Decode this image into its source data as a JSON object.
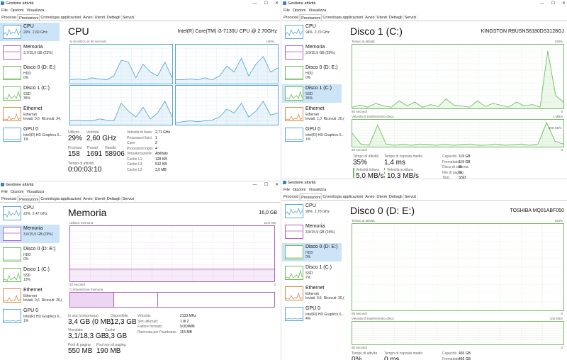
{
  "app_title": "Gestione attività",
  "menu": [
    "File",
    "Opzioni",
    "Visualizza"
  ],
  "tabs": [
    "Processi",
    "Prestazioni",
    "Cronologia applicazioni",
    "Avvio",
    "Utenti",
    "Dettagli",
    "Servizi"
  ],
  "win_buttons": [
    "—",
    "☐",
    "✕"
  ],
  "colors": {
    "cpu": "#5ba7d8",
    "mem": "#b05fc1",
    "disk": "#6fbf5e",
    "eth": "#d98c4b",
    "gpu": "#5ba7d8",
    "selected": "#cce4f7"
  },
  "w1": {
    "sidebar": [
      {
        "name": "CPU",
        "sub": "29%  2,60 GHz"
      },
      {
        "name": "Memoria",
        "sub": "3,7/15,9 GB (23%)"
      },
      {
        "name": "Disco 0 (D: E:)",
        "sub": "HDD\n0%"
      },
      {
        "name": "Disco 1 (C:)",
        "sub": "SSD\n35%"
      },
      {
        "name": "Ethernet",
        "sub": "Ethernet\nInviati: 0,6  Ricevuti: 34,"
      },
      {
        "name": "GPU 0",
        "sub": "Intel(R) HD Graphics 6...\n1%"
      }
    ],
    "title": "CPU",
    "subtitle": "Intel(R) Core(TM) i3-7130U CPU @ 2.70GHz",
    "graph_label": "% di utilizzo in 60 secondi",
    "graph_max": "100%",
    "stats": [
      {
        "label": "Utilizzo",
        "value": "29%"
      },
      {
        "label": "Velocità",
        "value": "2,60 GHz"
      },
      {
        "label": "Processi",
        "value": "158"
      },
      {
        "label": "Thread",
        "value": "1691"
      },
      {
        "label": "Handle",
        "value": "58906"
      },
      {
        "label": "Tempo di attività",
        "value": "0:00:03:10"
      }
    ],
    "kv": [
      {
        "k": "Velocità di base:",
        "v": "2,71 GHz"
      },
      {
        "k": "Processori fisici:",
        "v": "1"
      },
      {
        "k": "Core:",
        "v": "2"
      },
      {
        "k": "Processori logici:",
        "v": "4"
      },
      {
        "k": "Virtualizzazione:",
        "v": "Abilitato"
      },
      {
        "k": "Cache L1:",
        "v": "128 KB"
      },
      {
        "k": "Cache L2:",
        "v": "512 KB"
      },
      {
        "k": "Cache L3:",
        "v": "3,0 MB"
      }
    ]
  },
  "w2": {
    "sidebar": [
      {
        "name": "CPU",
        "sub": "94%  2,70 GHz"
      },
      {
        "name": "Memoria",
        "sub": "3,9/15,9 GB (25%)"
      },
      {
        "name": "Disco 0 (D: E:)",
        "sub": "HDD\n0%"
      },
      {
        "name": "Disco 1 (C:)",
        "sub": "SSD\n35%"
      },
      {
        "name": "Ethernet",
        "sub": "Ethernet\nInviati: 1,0  Ricevuti: 26,("
      },
      {
        "name": "GPU 0",
        "sub": "Intel(R) HD Graphics 6...\n1%"
      }
    ],
    "title": "Disco 1 (C:)",
    "subtitle": "KINGSTON RBUSNS8180DS3128GJ",
    "g1_label": "Tempo di attività",
    "g1_max": "100%",
    "g1_left": "60 secondi",
    "g1_right": "0",
    "g2_label": "Velocità di trasferimento disco",
    "g2_max": "1 MB/s",
    "g2_mid": "800 KB/s",
    "g2_left": "60 secondi",
    "g2_right": "0",
    "stats": [
      {
        "label": "Tempo di attività",
        "value": "35%"
      },
      {
        "label": "Tempo di risposta medio",
        "value": "1,4 ms"
      },
      {
        "label": "Velocità lettura",
        "value": "5,0 MB/s"
      },
      {
        "label": "Velocità scrittura",
        "value": "10,3 MB/s"
      }
    ],
    "kv": [
      {
        "k": "Capacità:",
        "v": "119 GB"
      },
      {
        "k": "Formattato:",
        "v": "119 GB"
      },
      {
        "k": "Disco di sistema:",
        "v": "Sì"
      },
      {
        "k": "File di paging:",
        "v": "Sì"
      },
      {
        "k": "Tipo:",
        "v": "SSD"
      }
    ]
  },
  "w3": {
    "sidebar": [
      {
        "name": "CPU",
        "sub": "22%  2,47 GHz"
      },
      {
        "name": "Memoria",
        "sub": "3,6/15,9 GB (23%)"
      },
      {
        "name": "Disco 0 (D: E:)",
        "sub": "HDD\n0%"
      },
      {
        "name": "Disco 1 (C:)",
        "sub": "SSD\n13%"
      },
      {
        "name": "Ethernet",
        "sub": "Ethernet\nInviati: 0,6  Ricevuti: 36,("
      },
      {
        "name": "GPU 0",
        "sub": "Intel(R) HD Graphics 6...\n1%"
      }
    ],
    "title": "Memoria",
    "subtitle": "16,0 GB",
    "g1_label": "Utilizzo memoria",
    "g1_max": "15,9 GB",
    "g1_left": "60 secondi",
    "g1_right": "0",
    "g2_label": "Composizione memoria",
    "stats": [
      {
        "label": "In uso (compressa)",
        "value": "3,4 GB (0 MB)"
      },
      {
        "label": "Disponibile",
        "value": "12,3 GB"
      },
      {
        "label": "Vincolata",
        "value": "3,1/18,3 GB"
      },
      {
        "label": "Cache",
        "value": "3,3 GB"
      },
      {
        "label": "Pool di paging",
        "value": "550 MB"
      },
      {
        "label": "Pool non di paging",
        "value": "190 MB"
      }
    ],
    "kv": [
      {
        "k": "Velocità:",
        "v": "2133 MHz"
      },
      {
        "k": "Slot utilizzati:",
        "v": "1 di 2"
      },
      {
        "k": "Fattore formato:",
        "v": "SODIMM"
      },
      {
        "k": "Riservata per l'hardware:",
        "v": "115 MB"
      }
    ]
  },
  "w4": {
    "sidebar": [
      {
        "name": "CPU",
        "sub": "99%  2,70 GHz"
      },
      {
        "name": "Memoria",
        "sub": "3,8/15,9 GB (24%)"
      },
      {
        "name": "Disco 0 (D: E:)",
        "sub": "HDD\n0%"
      },
      {
        "name": "Disco 1 (C:)",
        "sub": "SSD\n7%"
      },
      {
        "name": "Ethernet",
        "sub": "Ethernet\nInviati: 0,5  Ricevuti: 26,("
      },
      {
        "name": "GPU 0",
        "sub": "Intel(R) HD Graphics 6...\n4%"
      }
    ],
    "title": "Disco 0 (D: E:)",
    "subtitle": "TOSHIBA MQ01ABF050",
    "g1_label": "Tempo di attività",
    "g1_max": "100%",
    "g1_left": "60 secondi",
    "g1_right": "0",
    "g2_label": "Velocità di trasferimento disco",
    "g2_max": "100 KB/s",
    "g2_left": "60 secondi",
    "g2_right": "0",
    "stats": [
      {
        "label": "Tempo di attività",
        "value": "0%"
      },
      {
        "label": "Tempo di risposta medio",
        "value": "0 ms"
      },
      {
        "label": "Velocità lettura",
        "value": "0 KB/s"
      },
      {
        "label": "Velocità scrittura",
        "value": "0 KB/s"
      }
    ],
    "kv": [
      {
        "k": "Capacità:",
        "v": "466 GB"
      },
      {
        "k": "Formattato:",
        "v": "466 GB"
      },
      {
        "k": "Disco di sistema:",
        "v": "No"
      },
      {
        "k": "File di paging:",
        "v": "No"
      },
      {
        "k": "Tipo:",
        "v": "HDD"
      }
    ]
  }
}
